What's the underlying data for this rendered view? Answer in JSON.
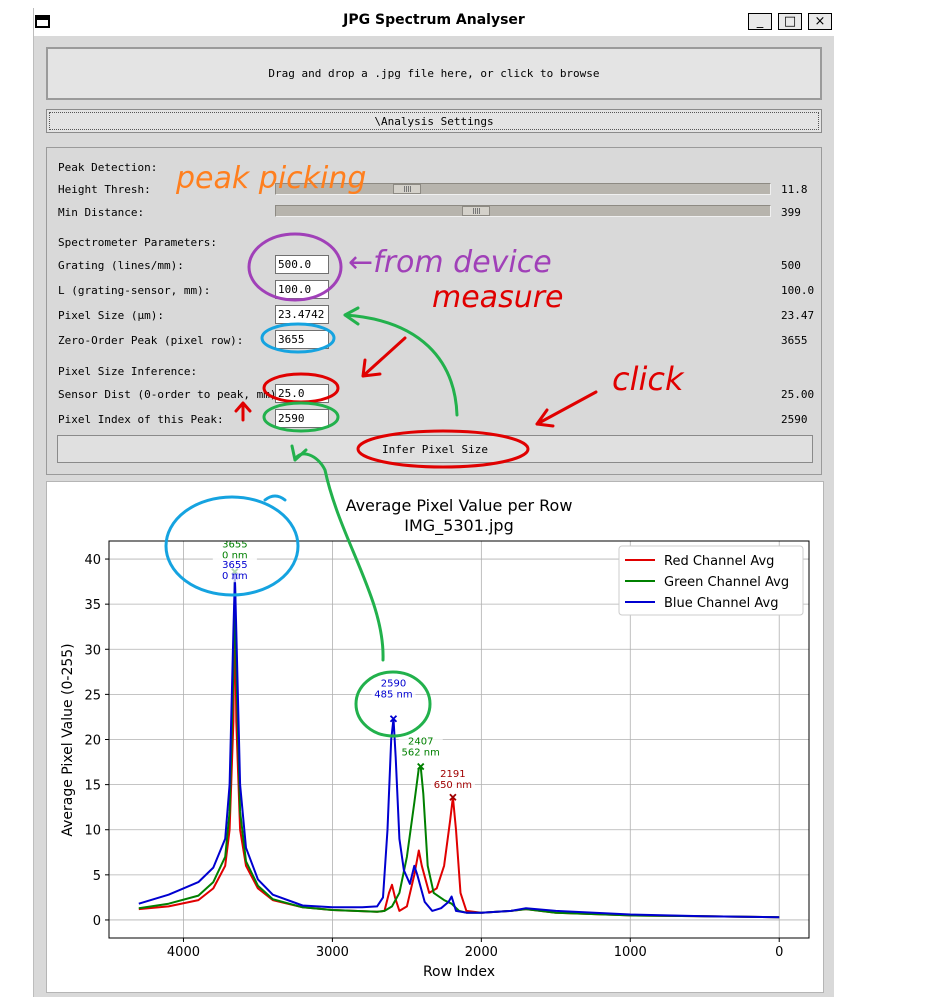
{
  "window": {
    "title": "JPG Spectrum Analyser",
    "minimize": "_",
    "maximize": "□",
    "close": "×"
  },
  "dropzone": {
    "text": "Drag and drop a .jpg file here, or click to browse"
  },
  "settings_toggle": {
    "label": "\\Analysis Settings"
  },
  "peak_detection": {
    "heading": "Peak Detection:",
    "height_thresh": {
      "label": "Height Thresh:",
      "value": "11.8",
      "level": 0.25
    },
    "min_distance": {
      "label": "Min Distance:",
      "value": "399",
      "level": 0.4
    }
  },
  "spectrometer": {
    "heading": "Spectrometer Parameters:",
    "grating": {
      "label": "Grating (lines/mm):",
      "input": "500.0",
      "value": "500"
    },
    "length": {
      "label": "L (grating-sensor, mm):",
      "input": "100.0",
      "value": "100.0"
    },
    "pixel_size": {
      "label": "Pixel Size (μm):",
      "input": "23.4742",
      "value": "23.47"
    },
    "zero_order": {
      "label": "Zero-Order Peak (pixel row):",
      "input": "3655",
      "value": "3655"
    }
  },
  "inference": {
    "heading": "Pixel Size Inference:",
    "sensor_dist": {
      "label": "Sensor Dist (0-order to peak, mm):",
      "input": "25.0",
      "value": "25.00"
    },
    "pixel_index": {
      "label": "Pixel Index of this Peak:",
      "input": "2590",
      "value": "2590"
    },
    "button": "Infer Pixel Size"
  },
  "annotations": {
    "peak_picking": "peak picking",
    "from_device": "←from device",
    "measure": "measure",
    "click": "click"
  },
  "colors": {
    "red": "#e00000",
    "green": "#008000",
    "blue": "#0000d0",
    "ink_orange": "#ff7f1e",
    "ink_purple": "#a040b8",
    "ink_green": "#22b14c",
    "ink_cyan": "#15a3e0"
  },
  "chart_data": {
    "type": "line",
    "title": "Average Pixel Value per Row",
    "subtitle": "IMG_5301.jpg",
    "xlabel": "Row Index",
    "ylabel": "Average Pixel Value (0-255)",
    "xlim": [
      4500,
      -200
    ],
    "ylim": [
      -2,
      42
    ],
    "xticks": [
      4000,
      3000,
      2000,
      1000,
      0
    ],
    "yticks": [
      0,
      5,
      10,
      15,
      20,
      25,
      30,
      35,
      40
    ],
    "grid": true,
    "legend": "top-right",
    "series": [
      {
        "name": "Red Channel Avg",
        "color": "#e00000",
        "points": [
          [
            4300,
            1.2
          ],
          [
            4100,
            1.5
          ],
          [
            3900,
            2.2
          ],
          [
            3800,
            3.5
          ],
          [
            3720,
            6
          ],
          [
            3690,
            10
          ],
          [
            3665,
            22
          ],
          [
            3655,
            36
          ],
          [
            3645,
            22
          ],
          [
            3620,
            10
          ],
          [
            3580,
            6
          ],
          [
            3500,
            3.5
          ],
          [
            3400,
            2.2
          ],
          [
            3200,
            1.4
          ],
          [
            3000,
            1.1
          ],
          [
            2700,
            0.9
          ],
          [
            2650,
            1.0
          ],
          [
            2620,
            3
          ],
          [
            2600,
            3.9
          ],
          [
            2580,
            2.5
          ],
          [
            2550,
            1.0
          ],
          [
            2500,
            1.5
          ],
          [
            2450,
            5
          ],
          [
            2420,
            7.7
          ],
          [
            2400,
            6
          ],
          [
            2350,
            3
          ],
          [
            2300,
            3.5
          ],
          [
            2250,
            6
          ],
          [
            2210,
            11
          ],
          [
            2191,
            13.6
          ],
          [
            2170,
            10
          ],
          [
            2140,
            3
          ],
          [
            2100,
            1.0
          ],
          [
            2000,
            0.8
          ],
          [
            1800,
            1.0
          ],
          [
            1700,
            1.2
          ],
          [
            1500,
            0.8
          ],
          [
            1000,
            0.5
          ],
          [
            500,
            0.4
          ],
          [
            0,
            0.3
          ]
        ]
      },
      {
        "name": "Green Channel Avg",
        "color": "#008000",
        "points": [
          [
            4300,
            1.3
          ],
          [
            4100,
            1.8
          ],
          [
            3900,
            2.7
          ],
          [
            3800,
            4.2
          ],
          [
            3720,
            7
          ],
          [
            3690,
            12
          ],
          [
            3665,
            28
          ],
          [
            3655,
            38
          ],
          [
            3645,
            28
          ],
          [
            3620,
            12
          ],
          [
            3580,
            6.5
          ],
          [
            3500,
            3.8
          ],
          [
            3400,
            2.3
          ],
          [
            3200,
            1.4
          ],
          [
            3000,
            1.1
          ],
          [
            2700,
            0.9
          ],
          [
            2650,
            1.0
          ],
          [
            2600,
            1.5
          ],
          [
            2550,
            3
          ],
          [
            2500,
            7
          ],
          [
            2450,
            13
          ],
          [
            2420,
            16.8
          ],
          [
            2407,
            17
          ],
          [
            2390,
            14
          ],
          [
            2360,
            6
          ],
          [
            2320,
            3
          ],
          [
            2250,
            2.2
          ],
          [
            2200,
            1.8
          ],
          [
            2150,
            1.0
          ],
          [
            2100,
            0.8
          ],
          [
            2000,
            0.8
          ],
          [
            1800,
            1.0
          ],
          [
            1700,
            1.2
          ],
          [
            1500,
            0.8
          ],
          [
            1000,
            0.5
          ],
          [
            500,
            0.4
          ],
          [
            0,
            0.3
          ]
        ]
      },
      {
        "name": "Blue Channel Avg",
        "color": "#0000d0",
        "points": [
          [
            4300,
            1.8
          ],
          [
            4100,
            2.8
          ],
          [
            3900,
            4.2
          ],
          [
            3800,
            5.8
          ],
          [
            3720,
            9
          ],
          [
            3690,
            15
          ],
          [
            3665,
            32
          ],
          [
            3655,
            38
          ],
          [
            3645,
            32
          ],
          [
            3620,
            15
          ],
          [
            3580,
            8
          ],
          [
            3500,
            4.5
          ],
          [
            3400,
            2.8
          ],
          [
            3200,
            1.6
          ],
          [
            3000,
            1.4
          ],
          [
            2800,
            1.4
          ],
          [
            2700,
            1.5
          ],
          [
            2660,
            2.5
          ],
          [
            2630,
            10
          ],
          [
            2605,
            20
          ],
          [
            2590,
            22.3
          ],
          [
            2575,
            18
          ],
          [
            2550,
            9
          ],
          [
            2520,
            5.5
          ],
          [
            2480,
            4
          ],
          [
            2450,
            6
          ],
          [
            2430,
            5
          ],
          [
            2380,
            2
          ],
          [
            2330,
            1.0
          ],
          [
            2270,
            1.3
          ],
          [
            2220,
            2
          ],
          [
            2200,
            2.6
          ],
          [
            2170,
            1.0
          ],
          [
            2100,
            0.8
          ],
          [
            2000,
            0.8
          ],
          [
            1800,
            1.0
          ],
          [
            1700,
            1.3
          ],
          [
            1500,
            1.0
          ],
          [
            1000,
            0.6
          ],
          [
            500,
            0.4
          ],
          [
            0,
            0.3
          ]
        ]
      }
    ],
    "peak_markers": [
      {
        "x": 3655,
        "y": 38.6,
        "color": "#008000",
        "label_row": "3655",
        "label_nm": "0 nm"
      },
      {
        "x": 3655,
        "y": 38.1,
        "color": "#0000d0",
        "label_row": "3655",
        "label_nm": "0 nm"
      },
      {
        "x": 2590,
        "y": 22.3,
        "color": "#0000d0",
        "label_row": "2590",
        "label_nm": "485 nm"
      },
      {
        "x": 2407,
        "y": 17.0,
        "color": "#008000",
        "label_row": "2407",
        "label_nm": "562 nm"
      },
      {
        "x": 2191,
        "y": 13.6,
        "color": "#a00000",
        "label_row": "2191",
        "label_nm": "650 nm"
      }
    ]
  }
}
